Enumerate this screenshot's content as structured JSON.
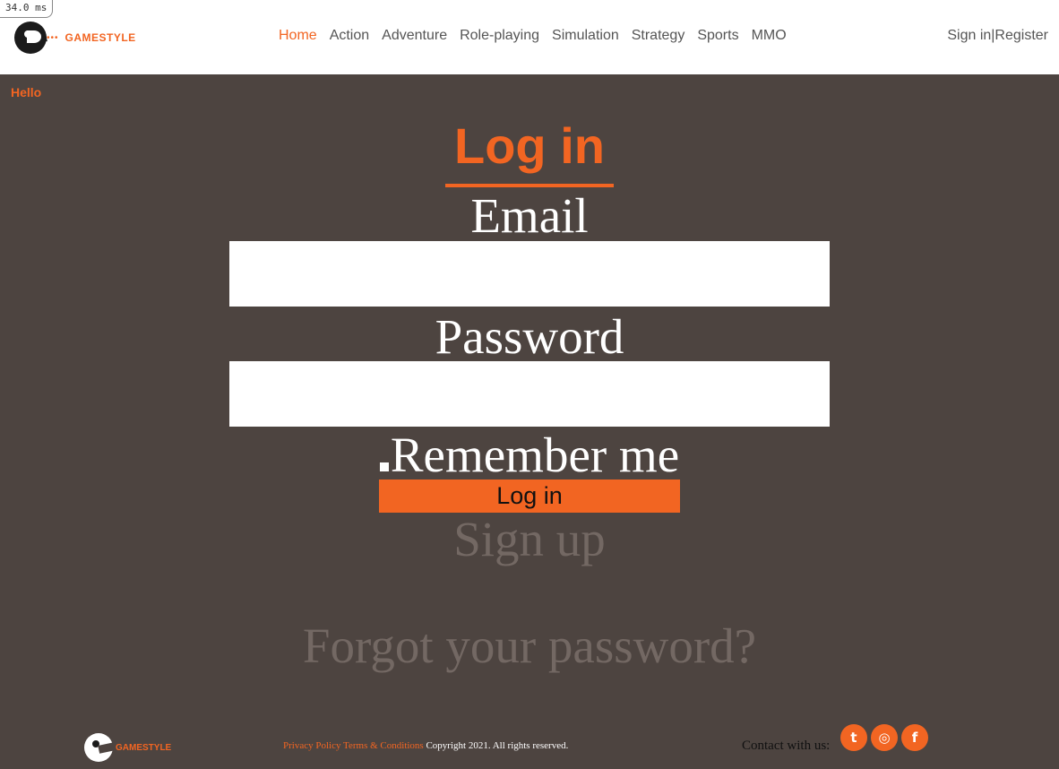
{
  "debug": {
    "timing": "34.0 ms"
  },
  "brand": {
    "name": "GAMESTYLE",
    "dots": "•••",
    "accent": "#f26522",
    "background": "#4d4440"
  },
  "nav": {
    "items": [
      {
        "label": "Home",
        "active": true
      },
      {
        "label": "Action"
      },
      {
        "label": "Adventure"
      },
      {
        "label": "Role-playing"
      },
      {
        "label": "Simulation"
      },
      {
        "label": "Strategy"
      },
      {
        "label": "Sports"
      },
      {
        "label": "MMO"
      }
    ],
    "sign_in": "Sign in",
    "separator": "|",
    "register": "Register"
  },
  "greeting": "Hello",
  "form": {
    "title": "Log in",
    "email_label": "Email",
    "email_value": "",
    "password_label": "Password",
    "password_value": "",
    "remember_label": "Remember me",
    "submit_label": "Log in",
    "signup_link": "Sign up",
    "forgot_link": "Forgot your password?"
  },
  "footer": {
    "privacy": "Privacy Policy",
    "terms": "Terms & Conditions",
    "copyright": "Copyright 2021. All rights reserved.",
    "contact": "Contact with us:",
    "social": [
      "twitter-icon",
      "instagram-icon",
      "facebook-icon"
    ]
  }
}
